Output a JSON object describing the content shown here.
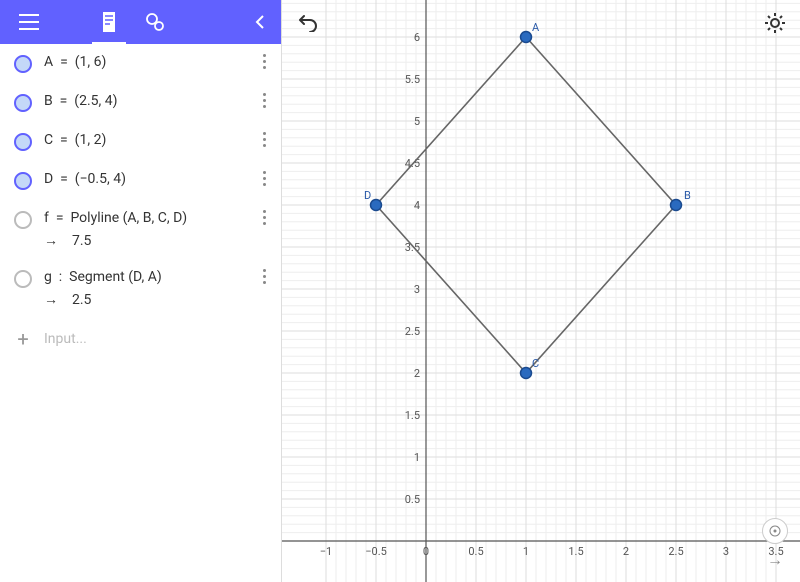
{
  "topbar": {},
  "items": [
    {
      "name": "A",
      "expr": "A  =  (1, 6)",
      "toggle": "on",
      "menu": true
    },
    {
      "name": "B",
      "expr": "B  =  (2.5, 4)",
      "toggle": "on",
      "menu": true
    },
    {
      "name": "C",
      "expr": "C  =  (1, 2)",
      "toggle": "on",
      "menu": true
    },
    {
      "name": "D",
      "expr": "D  =  (−0.5, 4)",
      "toggle": "on",
      "menu": true
    },
    {
      "name": "f",
      "expr": "f  =  Polyline (A, B, C, D)",
      "toggle": "off",
      "menu": true,
      "result": "7.5"
    },
    {
      "name": "g",
      "expr": "g  :  Segment (D, A)",
      "toggle": "off",
      "menu": true,
      "result": "2.5"
    }
  ],
  "input_placeholder": "Input...",
  "chart_data": {
    "type": "scatter",
    "title": "",
    "xlabel": "",
    "ylabel": "",
    "xlim": [
      -1,
      3.5
    ],
    "ylim": [
      0,
      6.5
    ],
    "x_ticks": [
      -1,
      -0.5,
      0,
      0.5,
      1,
      1.5,
      2,
      2.5,
      3,
      3.5
    ],
    "y_ticks": [
      0.5,
      1,
      1.5,
      2,
      2.5,
      3,
      3.5,
      4,
      4.5,
      5,
      5.5,
      6
    ],
    "points": {
      "A": {
        "x": 1,
        "y": 6
      },
      "B": {
        "x": 2.5,
        "y": 4
      },
      "C": {
        "x": 1,
        "y": 2
      },
      "D": {
        "x": -0.5,
        "y": 4
      }
    },
    "polyline": "A,B,C,D",
    "segment": "D,A"
  }
}
